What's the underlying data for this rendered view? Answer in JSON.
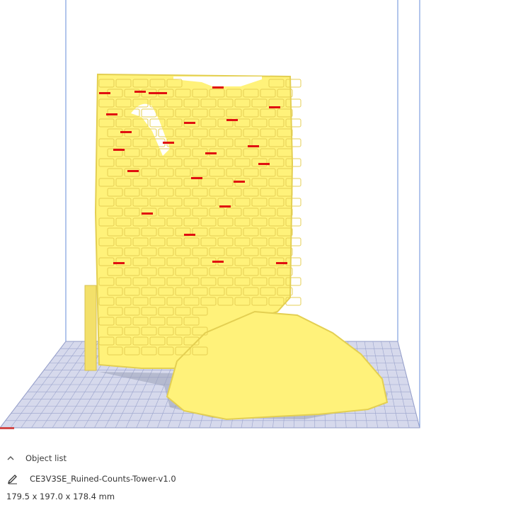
{
  "object_list": {
    "title": "Object list",
    "expand_icon": "chevron-up-icon",
    "edit_icon": "pencil-icon"
  },
  "object": {
    "name": "CE3V3SE_Ruined-Counts-Tower-v1.0",
    "dimensions": "179.5 x 197.0 x 178.4 mm"
  },
  "colors": {
    "model": "#fff27a",
    "model_shadow": "#e3cf52",
    "overhang": "#e01010",
    "build_volume_edge": "#6f93d8",
    "build_plate": "#ccd1e8",
    "grid": "#8a94c4"
  }
}
